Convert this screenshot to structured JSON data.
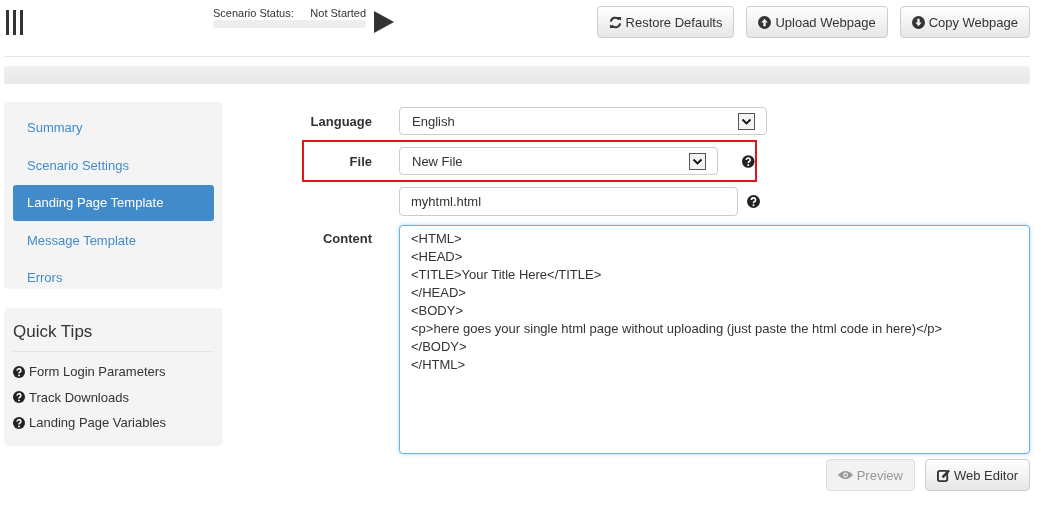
{
  "header": {
    "status_label": "Scenario Status:",
    "status_value": "Not Started",
    "progress": {
      "level": 0
    },
    "buttons": [
      {
        "label": "Restore Defaults",
        "kind": "refresh"
      },
      {
        "label": "Upload Webpage",
        "kind": "upload"
      },
      {
        "label": "Copy Webpage",
        "kind": "download"
      }
    ]
  },
  "sidebar": {
    "items": [
      {
        "label": "Summary",
        "selected": false
      },
      {
        "label": "Scenario Settings",
        "selected": false
      },
      {
        "label": "Landing Page Template",
        "selected": true
      },
      {
        "label": "Message Template",
        "selected": false
      },
      {
        "label": "Errors",
        "selected": false
      }
    ]
  },
  "quick_tips": {
    "title": "Quick Tips",
    "items": [
      "Form Login Parameters",
      "Track Downloads",
      "Landing Page Variables"
    ]
  },
  "form": {
    "language": {
      "label": "Language",
      "value": "English"
    },
    "file": {
      "label": "File",
      "value": "New File",
      "highlighted": true
    },
    "filename": {
      "value": "myhtml.html"
    },
    "content": {
      "label": "Content",
      "value": "<HTML>\n<HEAD>\n<TITLE>Your Title Here</TITLE>\n</HEAD>\n<BODY>\n<p>here goes your single html page without uploading (just paste the html code in here)</p>\n</BODY>\n</HTML>"
    }
  },
  "footer_buttons": [
    {
      "label": "Preview",
      "kind": "preview",
      "disabled": true
    },
    {
      "label": "Web Editor",
      "kind": "edit",
      "disabled": false
    }
  ]
}
